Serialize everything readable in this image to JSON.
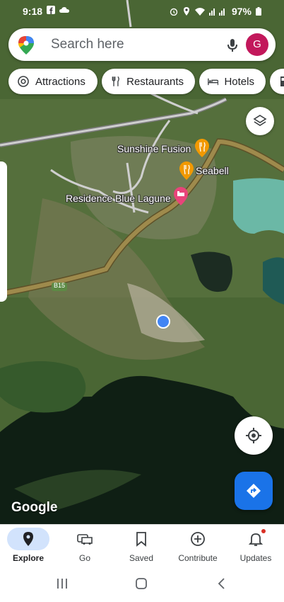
{
  "status_bar": {
    "time": "9:18",
    "battery": "97%",
    "icons": [
      "facebook-icon",
      "cloud-icon",
      "alarm-icon",
      "location-icon",
      "wifi-icon",
      "signal-icon",
      "battery-icon"
    ]
  },
  "search": {
    "placeholder": "Search here",
    "avatar_initial": "G"
  },
  "chips": [
    {
      "label": "Attractions",
      "icon": "camera-icon"
    },
    {
      "label": "Restaurants",
      "icon": "fork-knife-icon"
    },
    {
      "label": "Hotels",
      "icon": "bed-icon"
    }
  ],
  "map": {
    "places": [
      {
        "name": "Sunshine Fusion",
        "type": "restaurant"
      },
      {
        "name": "Seabell",
        "type": "restaurant"
      },
      {
        "name": "Residence Blue Lagune",
        "type": "hotel"
      }
    ],
    "road_label": "B15",
    "logo": "Google"
  },
  "colors": {
    "accent": "#1a73e8",
    "restaurant_pin": "#f29900",
    "hotel_pin": "#e8447a",
    "avatar": "#c2185b",
    "nav_active": "#d2e3fc"
  },
  "bottom_nav": [
    {
      "label": "Explore",
      "icon": "location-pin-icon",
      "active": true
    },
    {
      "label": "Go",
      "icon": "car-icon"
    },
    {
      "label": "Saved",
      "icon": "bookmark-icon"
    },
    {
      "label": "Contribute",
      "icon": "add-circle-icon"
    },
    {
      "label": "Updates",
      "icon": "bell-icon",
      "badge": true
    }
  ]
}
